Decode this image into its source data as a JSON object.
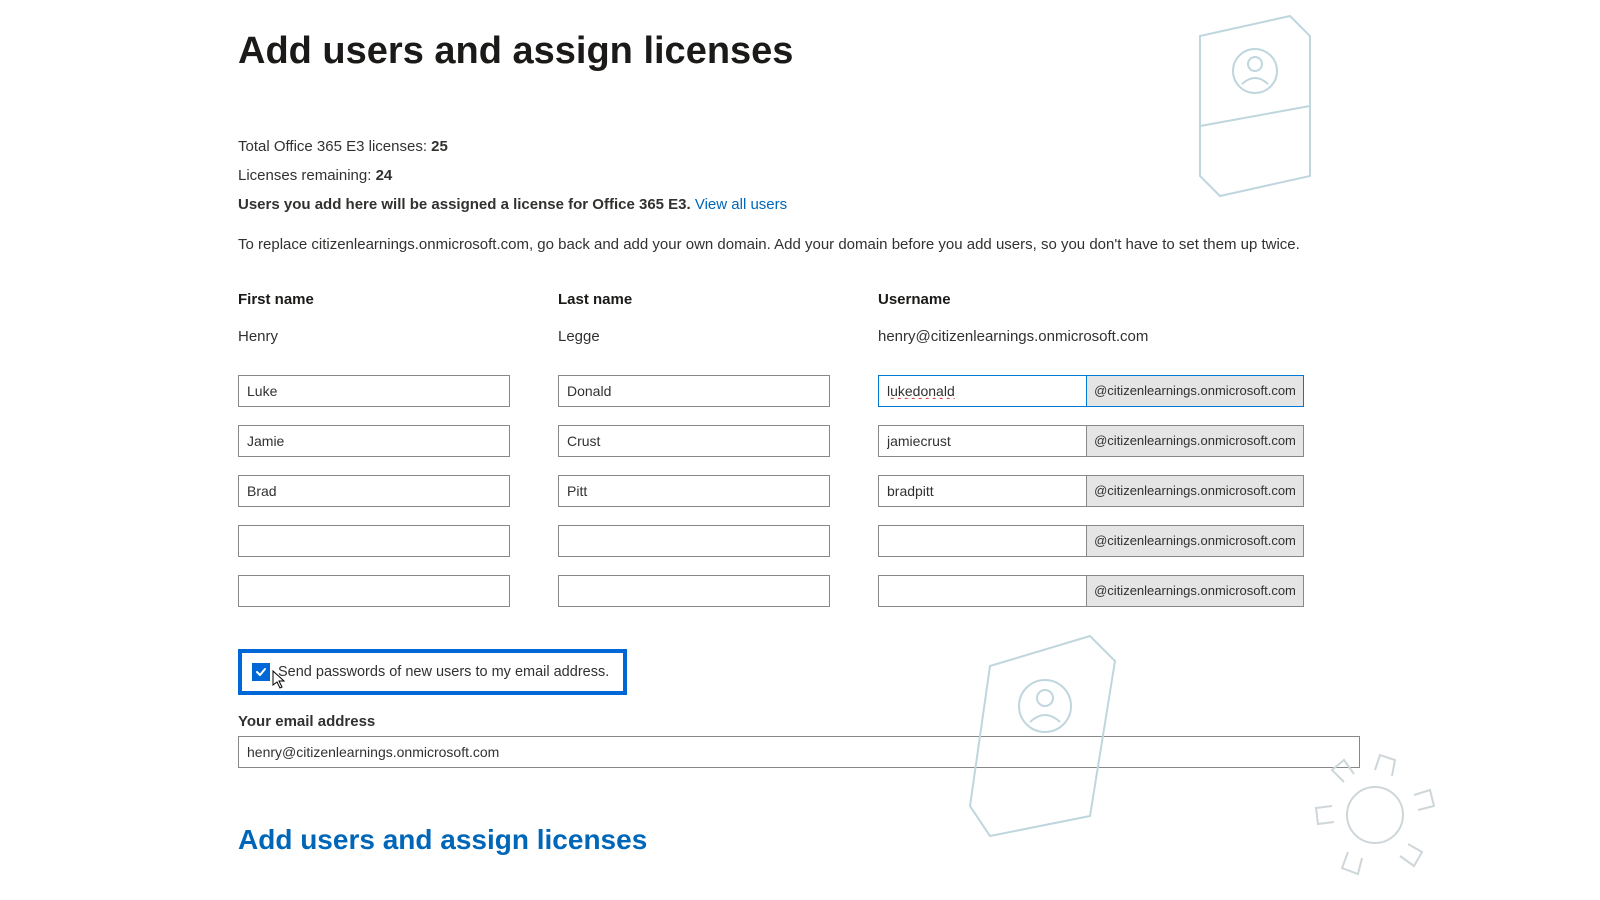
{
  "page": {
    "title": "Add users and assign licenses",
    "bottom_title": "Add users and assign licenses"
  },
  "licenses": {
    "total_label": "Total Office 365 E3 licenses:",
    "total_value": "25",
    "remaining_label": "Licenses remaining:",
    "remaining_value": "24",
    "assign_text": "Users you add here will be assigned a license for Office 365 E3.",
    "view_all_link": "View all users",
    "domain_hint": "To replace citizenlearnings.onmicrosoft.com, go back and add your own domain. Add your domain before you add users, so you don't have to set them up twice."
  },
  "columns": {
    "first_name": "First name",
    "last_name": "Last name",
    "username": "Username"
  },
  "existing_user": {
    "first_name": "Henry",
    "last_name": "Legge",
    "username": "henry@citizenlearnings.onmicrosoft.com"
  },
  "domain_suffix": "@citizenlearnings.onmicrosoft.com",
  "rows": [
    {
      "first": "Luke",
      "last": "Donald",
      "user": "lukedonald",
      "spell": true,
      "focused": true
    },
    {
      "first": "Jamie",
      "last": "Crust",
      "user": "jamiecrust",
      "spell": false,
      "focused": false
    },
    {
      "first": "Brad",
      "last": "Pitt",
      "user": "bradpitt",
      "spell": false,
      "focused": false
    },
    {
      "first": "",
      "last": "",
      "user": "",
      "spell": false,
      "focused": false
    },
    {
      "first": "",
      "last": "",
      "user": "",
      "spell": false,
      "focused": false
    }
  ],
  "send_passwords": {
    "checked": true,
    "label": "Send passwords of new users to my email address."
  },
  "email": {
    "label": "Your email address",
    "value": "henry@citizenlearnings.onmicrosoft.com"
  }
}
